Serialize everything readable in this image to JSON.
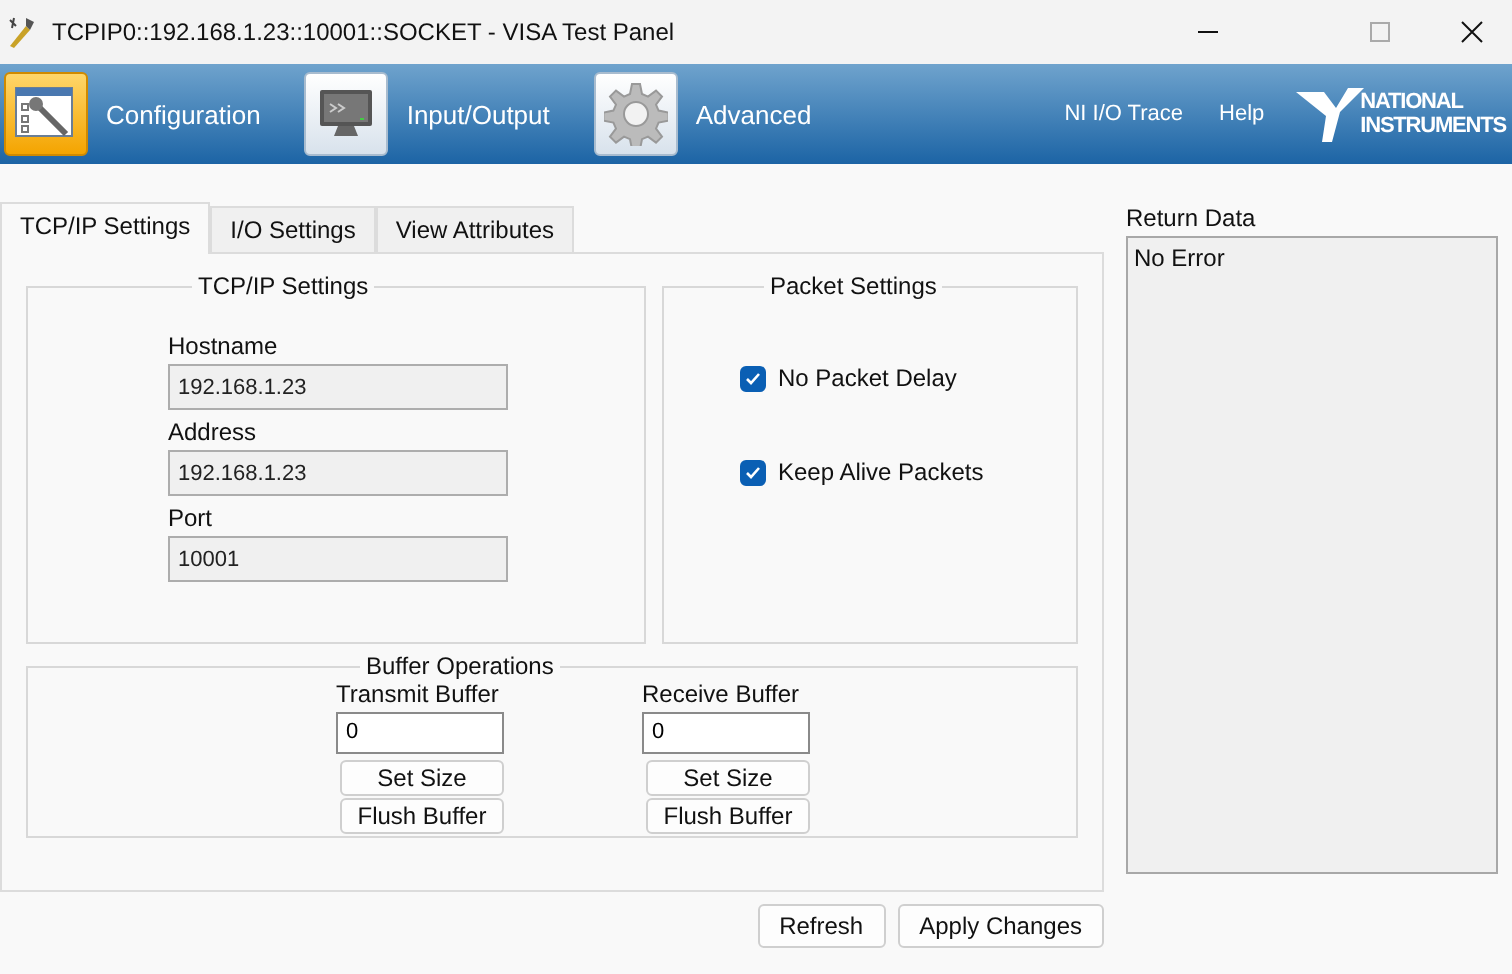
{
  "window": {
    "title": "TCPIP0::192.168.1.23::10001::SOCKET - VISA Test Panel"
  },
  "toolbar": {
    "buttons": [
      {
        "label": "Configuration",
        "kind": "config",
        "selected": true
      },
      {
        "label": "Input/Output",
        "kind": "io",
        "selected": false
      },
      {
        "label": "Advanced",
        "kind": "advanced",
        "selected": false
      }
    ],
    "links": [
      "NI I/O Trace",
      "Help"
    ],
    "logo": [
      "NATIONAL",
      "INSTRUMENTS"
    ]
  },
  "tabs": [
    {
      "label": "TCP/IP Settings",
      "selected": true
    },
    {
      "label": "I/O Settings",
      "selected": false
    },
    {
      "label": "View Attributes",
      "selected": false
    }
  ],
  "tcpip_settings": {
    "title": "TCP/IP Settings",
    "fields": [
      {
        "label": "Hostname",
        "value": "192.168.1.23"
      },
      {
        "label": "Address",
        "value": "192.168.1.23"
      },
      {
        "label": "Port",
        "value": "10001"
      }
    ]
  },
  "packet_settings": {
    "title": "Packet Settings",
    "options": [
      {
        "label": "No Packet Delay",
        "checked": true
      },
      {
        "label": "Keep Alive Packets",
        "checked": true
      }
    ]
  },
  "buffer_operations": {
    "title": "Buffer Operations",
    "buffers": [
      {
        "label": "Transmit Buffer",
        "value": "0",
        "buttons": [
          "Set Size",
          "Flush Buffer"
        ]
      },
      {
        "label": "Receive Buffer",
        "value": "0",
        "buttons": [
          "Set Size",
          "Flush Buffer"
        ]
      }
    ]
  },
  "return_data": {
    "label": "Return Data",
    "text": "No Error"
  },
  "buttons": [
    "Refresh",
    "Apply Changes"
  ]
}
